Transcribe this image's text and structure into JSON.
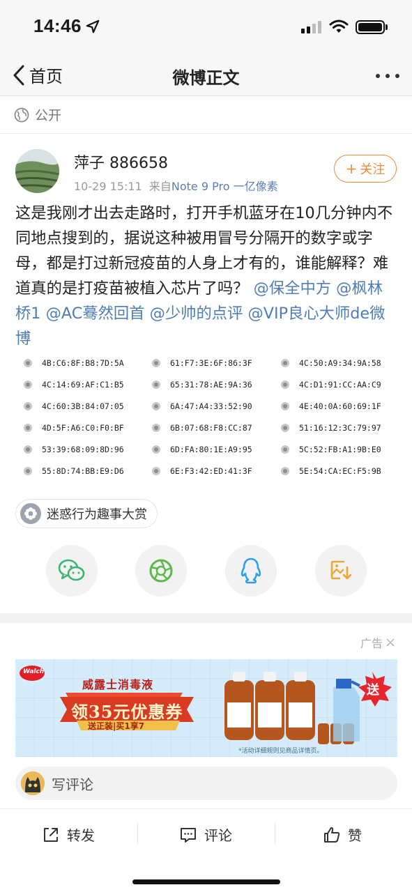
{
  "status": {
    "time": "14:46"
  },
  "nav": {
    "back_label": "首页",
    "title": "微博正文"
  },
  "visibility": {
    "label": "公开"
  },
  "post": {
    "username": "萍子 886658",
    "timestamp": "10-29 15:11",
    "source_prefix": "来自",
    "source": "Note 9 Pro 一亿像素",
    "follow_label": "关注",
    "text_main": "这是我刚才出去走路时，打开手机蓝牙在10几分钟内不同地点搜到的，据说这种被用冒号分隔开的数字或字母，都是打过新冠疫苗的人身上才有的，谁能解释？难道真的是打疫苗被植入芯片了吗？",
    "mentions": [
      "@保全中方",
      "@枫林桥1",
      "@AC蓦然回首",
      "@少帅的点评",
      "@VIP良心大师de微博"
    ]
  },
  "mac_columns": [
    [
      "4B:C6:8F:B8:7D:5A",
      "4C:14:69:AF:C1:B5",
      "4C:60:3B:84:07:05",
      "4D:5F:A6:C0:F0:BF",
      "53:39:68:09:8D:96",
      "55:8D:74:BB:E9:D6"
    ],
    [
      "61:F7:3E:6F:86:3F",
      "65:31:78:AE:9A:36",
      "6A:47:A4:33:52:90",
      "6B:07:68:F8:CC:87",
      "6D:FA:80:1E:A9:95",
      "6E:F3:42:ED:41:3F"
    ],
    [
      "4C:50:A9:34:9A:58",
      "4C:D1:91:CC:AA:C9",
      "4E:40:0A:60:69:1F",
      "51:16:12:3C:79:97",
      "5C:52:FB:A1:9B:E0",
      "5E:54:CA:EC:F5:9B"
    ]
  ],
  "topic": {
    "label": "迷惑行为趣事大赏"
  },
  "share": {
    "icons": [
      "wechat-icon",
      "moments-icon",
      "qq-icon",
      "save-image-icon"
    ]
  },
  "ad": {
    "label": "广告",
    "brand": "Walch",
    "headline": "威露士消毒液",
    "coupon": "领35元优惠券",
    "promo": "送正装|买1享7",
    "badge": "送",
    "disclaimer": "*活动详细规则见商品详情页。"
  },
  "comment": {
    "placeholder": "写评论"
  },
  "footer": {
    "repost": "转发",
    "comment": "评论",
    "like": "赞"
  },
  "colors": {
    "accent": "#f08a3c",
    "link": "#4f7db5",
    "muted": "#999999"
  }
}
